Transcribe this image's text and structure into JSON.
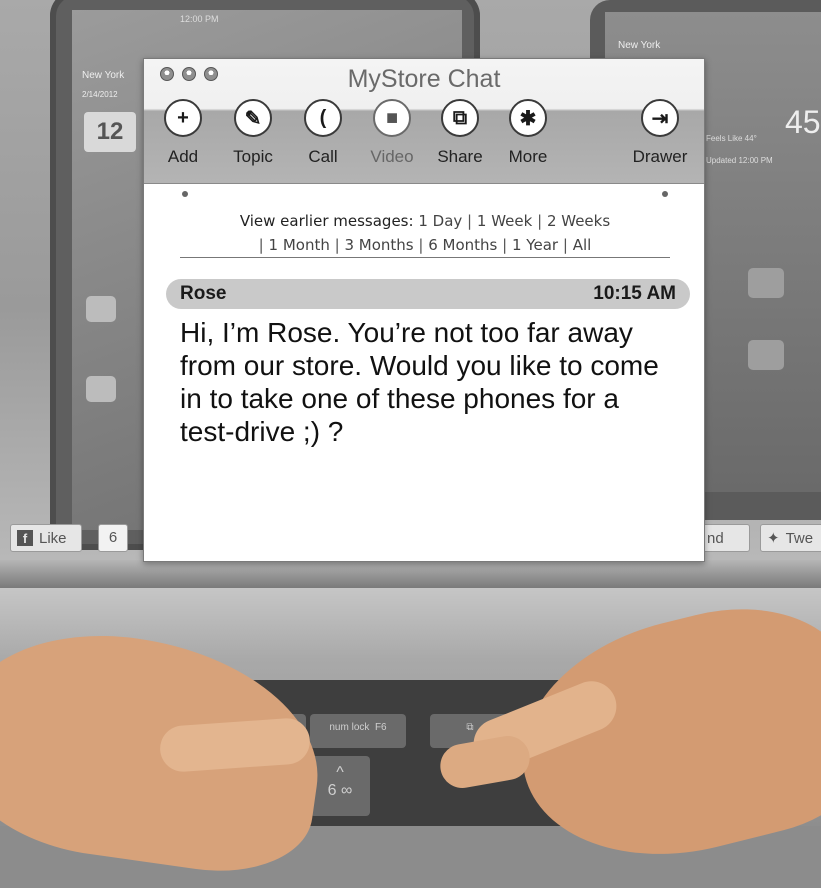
{
  "window": {
    "title": "MyStore Chat"
  },
  "toolbar": {
    "buttons": [
      {
        "label": "Add",
        "icon": "plus-icon",
        "glyph": "+"
      },
      {
        "label": "Topic",
        "icon": "edit-icon",
        "glyph": "✎"
      },
      {
        "label": "Call",
        "icon": "phone-icon",
        "glyph": "("
      },
      {
        "label": "Video",
        "icon": "video-camera-icon",
        "glyph": "■"
      },
      {
        "label": "Share",
        "icon": "share-icon",
        "glyph": "⧉"
      },
      {
        "label": "More",
        "icon": "gear-icon",
        "glyph": "✱"
      },
      {
        "label": "Drawer",
        "icon": "drawer-icon",
        "glyph": "⇥"
      }
    ]
  },
  "history": {
    "label": "View earlier messages:",
    "options": [
      "1 Day",
      "1 Week",
      "2 Weeks",
      "1 Month",
      "3 Months",
      "6 Months",
      "1 Year",
      "All"
    ]
  },
  "message": {
    "sender": "Rose",
    "time": "10:15 AM",
    "text": "Hi, I’m Rose.  You’re not too far away from our store.  Would you like to come in to take one of these phones for a test-drive ;) ?"
  },
  "background": {
    "left_phone": {
      "city": "New York",
      "date": "2/14/2012",
      "tile": "12",
      "status": "12:00 PM"
    },
    "right_phone": {
      "city": "New York",
      "temp": "45",
      "feels": "Feels Like 44°",
      "updated": "Updated 12:00 PM"
    },
    "social": {
      "like": "Like",
      "like_count": "6",
      "send": "nd",
      "tweet": "Twe"
    }
  },
  "colors": {
    "window_bg": "#ffffff",
    "toolbar_band": "#b0b0b0",
    "message_header": "#c9c9c9",
    "text": "#111111"
  }
}
